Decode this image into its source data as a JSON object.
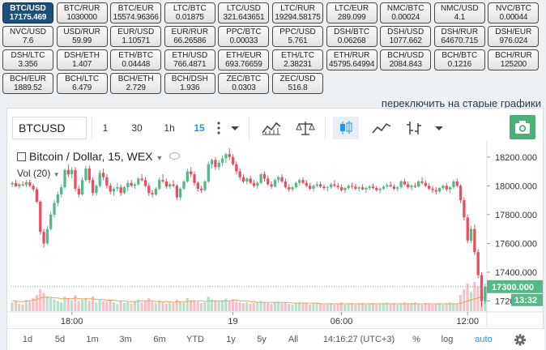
{
  "tickers": [
    {
      "pair": "BTC/USD",
      "value": "17175.469",
      "active": true
    },
    {
      "pair": "BTC/RUR",
      "value": "1030000"
    },
    {
      "pair": "BTC/EUR",
      "value": "15574.96366"
    },
    {
      "pair": "LTC/BTC",
      "value": "0.01875"
    },
    {
      "pair": "LTC/USD",
      "value": "321.643651"
    },
    {
      "pair": "LTC/RUR",
      "value": "19294.58175"
    },
    {
      "pair": "LTC/EUR",
      "value": "289.099"
    },
    {
      "pair": "NMC/BTC",
      "value": "0.00024"
    },
    {
      "pair": "NMC/USD",
      "value": "4.1"
    },
    {
      "pair": "NVC/BTC",
      "value": "0.00044"
    },
    {
      "pair": "NVC/USD",
      "value": "7.6"
    },
    {
      "pair": "USD/RUR",
      "value": "59.99"
    },
    {
      "pair": "EUR/USD",
      "value": "1.10571"
    },
    {
      "pair": "EUR/RUR",
      "value": "66.26586"
    },
    {
      "pair": "PPC/BTC",
      "value": "0.00033"
    },
    {
      "pair": "PPC/USD",
      "value": "5.761"
    },
    {
      "pair": "DSH/BTC",
      "value": "0.06268"
    },
    {
      "pair": "DSH/USD",
      "value": "1077.662"
    },
    {
      "pair": "DSH/RUR",
      "value": "64670.715"
    },
    {
      "pair": "DSH/EUR",
      "value": "976.024"
    },
    {
      "pair": "DSH/LTC",
      "value": "3.356"
    },
    {
      "pair": "DSH/ETH",
      "value": "1.407"
    },
    {
      "pair": "ETH/BTC",
      "value": "0.04448"
    },
    {
      "pair": "ETH/USD",
      "value": "766.4871"
    },
    {
      "pair": "ETH/EUR",
      "value": "693.76659"
    },
    {
      "pair": "ETH/LTC",
      "value": "2.38231"
    },
    {
      "pair": "ETH/RUR",
      "value": "45795.64994"
    },
    {
      "pair": "BCH/USD",
      "value": "2084.843"
    },
    {
      "pair": "BCH/BTC",
      "value": "0.1216"
    },
    {
      "pair": "BCH/RUR",
      "value": "125200"
    },
    {
      "pair": "BCH/EUR",
      "value": "1889.52"
    },
    {
      "pair": "BCH/LTC",
      "value": "6.479"
    },
    {
      "pair": "BCH/ETH",
      "value": "2.729"
    },
    {
      "pair": "BCH/DSH",
      "value": "1.936"
    },
    {
      "pair": "ZEC/BTC",
      "value": "0.0303"
    },
    {
      "pair": "ZEC/USD",
      "value": "516.8"
    }
  ],
  "switch_link": "переключить на старые графики",
  "toolbar": {
    "symbol": "BTCUSD",
    "intervals": [
      "1",
      "30",
      "1h",
      "15"
    ],
    "selected_interval": "15"
  },
  "legend": {
    "title": "Bitcoin / Dollar, 15, WEX",
    "volume": "Vol (20)"
  },
  "chart_data": {
    "type": "candlestick",
    "title": "Bitcoin / Dollar, 15, WEX",
    "y_ticks": [
      18200,
      18000,
      17800,
      17600,
      17400,
      17200
    ],
    "y_tick_labels": [
      "18200.000",
      "18000.000",
      "17800.000",
      "17600.000",
      "17400.000",
      "17200.000"
    ],
    "ylim": [
      17130,
      18300
    ],
    "x_tick_labels": [
      "18:00",
      "19",
      "06:00",
      "12:00"
    ],
    "x_tick_index": [
      17,
      63,
      94,
      130
    ],
    "last_price": "17300.000",
    "last_price_value": 17300,
    "countdown": "13:32",
    "candle_colors": {
      "up": "#53b987",
      "down": "#eb4d5c"
    },
    "candles": [
      [
        18010,
        18030,
        17990,
        18020
      ],
      [
        18020,
        18040,
        18000,
        17995
      ],
      [
        17995,
        18020,
        17980,
        18010
      ],
      [
        18010,
        18030,
        17995,
        18005
      ],
      [
        18005,
        18040,
        17990,
        18025
      ],
      [
        18025,
        18040,
        17990,
        18000
      ],
      [
        18000,
        18015,
        17960,
        17975
      ],
      [
        17975,
        17990,
        17880,
        17890
      ],
      [
        17890,
        17900,
        17660,
        17680
      ],
      [
        17680,
        17700,
        17570,
        17600
      ],
      [
        17600,
        17720,
        17590,
        17700
      ],
      [
        17700,
        17820,
        17690,
        17800
      ],
      [
        17800,
        17900,
        17780,
        17880
      ],
      [
        17880,
        17960,
        17860,
        17940
      ],
      [
        17940,
        18010,
        17920,
        17990
      ],
      [
        17990,
        18120,
        17980,
        18110
      ],
      [
        18110,
        18150,
        18060,
        18080
      ],
      [
        18080,
        18130,
        18050,
        18110
      ],
      [
        18110,
        18130,
        17960,
        17980
      ],
      [
        17980,
        18000,
        17920,
        17940
      ],
      [
        17940,
        18060,
        17930,
        18040
      ],
      [
        18040,
        18140,
        18030,
        18120
      ],
      [
        18120,
        18140,
        18020,
        18040
      ],
      [
        18040,
        18060,
        17930,
        17950
      ],
      [
        17950,
        18010,
        17930,
        18000
      ],
      [
        18000,
        18110,
        17990,
        18090
      ],
      [
        18090,
        18120,
        18040,
        18060
      ],
      [
        18060,
        18080,
        17980,
        18000
      ],
      [
        18000,
        18020,
        17940,
        17960
      ],
      [
        17960,
        17990,
        17930,
        17980
      ],
      [
        17980,
        18020,
        17960,
        17990
      ],
      [
        17990,
        18010,
        17930,
        17950
      ],
      [
        17950,
        18000,
        17940,
        17990
      ],
      [
        17990,
        18040,
        17960,
        18020
      ],
      [
        18020,
        18040,
        17990,
        18000
      ],
      [
        18000,
        18020,
        17980,
        18010
      ],
      [
        18010,
        18060,
        18000,
        18050
      ],
      [
        18050,
        18080,
        18030,
        18040
      ],
      [
        18040,
        18060,
        17990,
        18000
      ],
      [
        18000,
        18020,
        17930,
        17950
      ],
      [
        17950,
        17970,
        17920,
        17940
      ],
      [
        17940,
        17990,
        17930,
        17980
      ],
      [
        17980,
        18060,
        17970,
        18040
      ],
      [
        18040,
        18080,
        18020,
        18030
      ],
      [
        18030,
        18050,
        17980,
        17995
      ],
      [
        17995,
        18020,
        17980,
        18010
      ],
      [
        18010,
        18040,
        17990,
        18000
      ],
      [
        18000,
        18010,
        17900,
        17920
      ],
      [
        17920,
        17990,
        17900,
        17980
      ],
      [
        17980,
        18040,
        17970,
        18030
      ],
      [
        18030,
        18120,
        18020,
        18100
      ],
      [
        18100,
        18130,
        18060,
        18080
      ],
      [
        18080,
        18100,
        18000,
        18020
      ],
      [
        18020,
        18030,
        17960,
        17980
      ],
      [
        17980,
        18000,
        17950,
        17970
      ],
      [
        17970,
        18040,
        17960,
        18030
      ],
      [
        18030,
        18170,
        18020,
        18150
      ],
      [
        18150,
        18190,
        18120,
        18180
      ],
      [
        18180,
        18200,
        18110,
        18130
      ],
      [
        18130,
        18180,
        18110,
        18160
      ],
      [
        18160,
        18210,
        18140,
        18190
      ],
      [
        18190,
        18230,
        18160,
        18220
      ],
      [
        18220,
        18260,
        18180,
        18200
      ],
      [
        18200,
        18220,
        18140,
        18150
      ],
      [
        18150,
        18170,
        18080,
        18100
      ],
      [
        18100,
        18120,
        18040,
        18060
      ],
      [
        18060,
        18080,
        18020,
        18030
      ],
      [
        18030,
        18060,
        18010,
        18050
      ],
      [
        18050,
        18070,
        18010,
        18020
      ],
      [
        18020,
        18040,
        17990,
        18000
      ],
      [
        18000,
        18030,
        17980,
        18020
      ],
      [
        18020,
        18090,
        18010,
        18080
      ],
      [
        18080,
        18100,
        18030,
        18050
      ],
      [
        18050,
        18070,
        18000,
        18010
      ],
      [
        18010,
        18030,
        17980,
        17995
      ],
      [
        17995,
        18050,
        17990,
        18040
      ],
      [
        18040,
        18070,
        18020,
        18060
      ],
      [
        18060,
        18080,
        18020,
        18030
      ],
      [
        18030,
        18050,
        17980,
        17990
      ],
      [
        17990,
        18010,
        17960,
        17975
      ],
      [
        17975,
        18000,
        17960,
        17990
      ],
      [
        17990,
        18030,
        17980,
        18020
      ],
      [
        18020,
        18050,
        18000,
        18040
      ],
      [
        18040,
        18060,
        18010,
        18020
      ],
      [
        18020,
        18040,
        17990,
        18000
      ],
      [
        18000,
        18020,
        17970,
        17980
      ],
      [
        17980,
        18010,
        17960,
        18000
      ],
      [
        18000,
        18030,
        17990,
        18010
      ],
      [
        18010,
        18030,
        17985,
        17995
      ],
      [
        17995,
        18010,
        17970,
        17985
      ],
      [
        17985,
        18000,
        17960,
        17990
      ],
      [
        17990,
        18020,
        17980,
        18010
      ],
      [
        18010,
        18040,
        17990,
        18000
      ],
      [
        18000,
        18020,
        17975,
        17990
      ],
      [
        17990,
        18010,
        17960,
        17970
      ],
      [
        17970,
        17990,
        17950,
        17985
      ],
      [
        17985,
        18010,
        17975,
        18000
      ],
      [
        18000,
        18020,
        17980,
        17995
      ],
      [
        17995,
        18015,
        17970,
        17980
      ],
      [
        17980,
        18000,
        17960,
        17990
      ],
      [
        17990,
        18010,
        17970,
        17975
      ],
      [
        17975,
        17995,
        17950,
        17985
      ],
      [
        17985,
        18005,
        17970,
        17995
      ],
      [
        17995,
        18015,
        17975,
        17985
      ],
      [
        17985,
        18000,
        17960,
        17970
      ],
      [
        17970,
        17990,
        17950,
        17980
      ],
      [
        17980,
        18005,
        17970,
        17995
      ],
      [
        17995,
        18020,
        17980,
        18005
      ],
      [
        18005,
        18030,
        17990,
        17995
      ],
      [
        17995,
        18010,
        17970,
        17980
      ],
      [
        17980,
        18000,
        17960,
        17990
      ],
      [
        17990,
        18040,
        17980,
        18030
      ],
      [
        18030,
        18050,
        18000,
        18010
      ],
      [
        18010,
        18030,
        17980,
        17990
      ],
      [
        17990,
        18010,
        17970,
        18000
      ],
      [
        18000,
        18020,
        17985,
        17995
      ],
      [
        17995,
        18040,
        17990,
        18030
      ],
      [
        18030,
        18060,
        18010,
        18020
      ],
      [
        18020,
        18040,
        17990,
        18000
      ],
      [
        18000,
        18020,
        17970,
        17980
      ],
      [
        17980,
        18000,
        17950,
        17970
      ],
      [
        17970,
        17990,
        17940,
        17960
      ],
      [
        17960,
        17990,
        17950,
        17985
      ],
      [
        17985,
        18010,
        17970,
        18000
      ],
      [
        18000,
        18020,
        17960,
        17975
      ],
      [
        17975,
        17995,
        17950,
        17990
      ],
      [
        17990,
        18040,
        17980,
        18030
      ],
      [
        18030,
        18050,
        17990,
        18000
      ],
      [
        18000,
        18010,
        17880,
        17900
      ],
      [
        17900,
        17920,
        17760,
        17780
      ],
      [
        17780,
        17800,
        17600,
        17620
      ],
      [
        17620,
        17720,
        17600,
        17700
      ],
      [
        17700,
        17730,
        17520,
        17540
      ],
      [
        17540,
        17560,
        17360,
        17380
      ],
      [
        17380,
        17400,
        17160,
        17200
      ],
      [
        17200,
        17320,
        17180,
        17300
      ]
    ],
    "volumes": [
      12,
      14,
      10,
      9,
      15,
      13,
      18,
      22,
      30,
      25,
      20,
      18,
      16,
      14,
      12,
      20,
      18,
      15,
      22,
      14,
      16,
      18,
      14,
      20,
      12,
      16,
      14,
      13,
      15,
      12,
      10,
      14,
      11,
      12,
      10,
      13,
      16,
      12,
      14,
      18,
      13,
      11,
      15,
      12,
      10,
      12,
      11,
      16,
      13,
      12,
      18,
      15,
      14,
      13,
      11,
      12,
      20,
      16,
      14,
      13,
      15,
      17,
      14,
      16,
      13,
      12,
      11,
      12,
      10,
      11,
      12,
      14,
      12,
      11,
      10,
      12,
      13,
      11,
      12,
      10,
      9,
      11,
      12,
      10,
      11,
      9,
      10,
      11,
      10,
      9,
      10,
      11,
      9,
      10,
      12,
      9,
      10,
      11,
      9,
      10,
      11,
      9,
      10,
      11,
      9,
      10,
      11,
      12,
      10,
      11,
      9,
      10,
      12,
      10,
      11,
      12,
      10,
      9,
      11,
      10,
      9,
      10,
      11,
      9,
      10,
      12,
      11,
      10,
      22,
      30,
      38,
      26,
      40,
      34,
      28,
      20
    ],
    "volume_max": 40,
    "volume_ma": [
      14,
      14,
      13,
      13,
      14,
      14,
      15,
      16,
      18,
      19,
      19,
      19,
      18,
      18,
      17,
      17,
      17,
      17,
      18,
      17,
      17,
      17,
      17,
      17,
      16,
      16,
      16,
      15,
      15,
      15,
      14,
      14,
      14,
      13,
      13,
      13,
      14,
      14,
      14,
      14,
      14,
      13,
      13,
      13,
      13,
      13,
      12,
      13,
      13,
      13,
      13,
      14,
      14,
      14,
      14,
      13,
      14,
      14,
      14,
      14,
      14,
      14,
      14,
      15,
      15,
      14,
      14,
      14,
      13,
      13,
      12,
      12,
      12,
      12,
      12,
      12,
      12,
      12,
      12,
      12,
      11,
      11,
      11,
      11,
      11,
      11,
      11,
      11,
      10,
      10,
      10,
      10,
      10,
      10,
      10,
      10,
      10,
      10,
      10,
      10,
      10,
      10,
      10,
      10,
      10,
      10,
      10,
      10,
      10,
      10,
      10,
      10,
      10,
      10,
      10,
      10,
      10,
      10,
      10,
      10,
      10,
      10,
      10,
      10,
      10,
      10,
      10,
      10,
      11,
      12,
      14,
      15,
      17,
      18,
      19,
      19
    ]
  },
  "bottom_bar": {
    "ranges": [
      "1d",
      "5d",
      "1m",
      "3m",
      "6m",
      "YTD",
      "1y",
      "5y",
      "All"
    ],
    "time": "14:16:27 (UTC+3)",
    "percent": "%",
    "log": "log",
    "auto": "auto"
  }
}
